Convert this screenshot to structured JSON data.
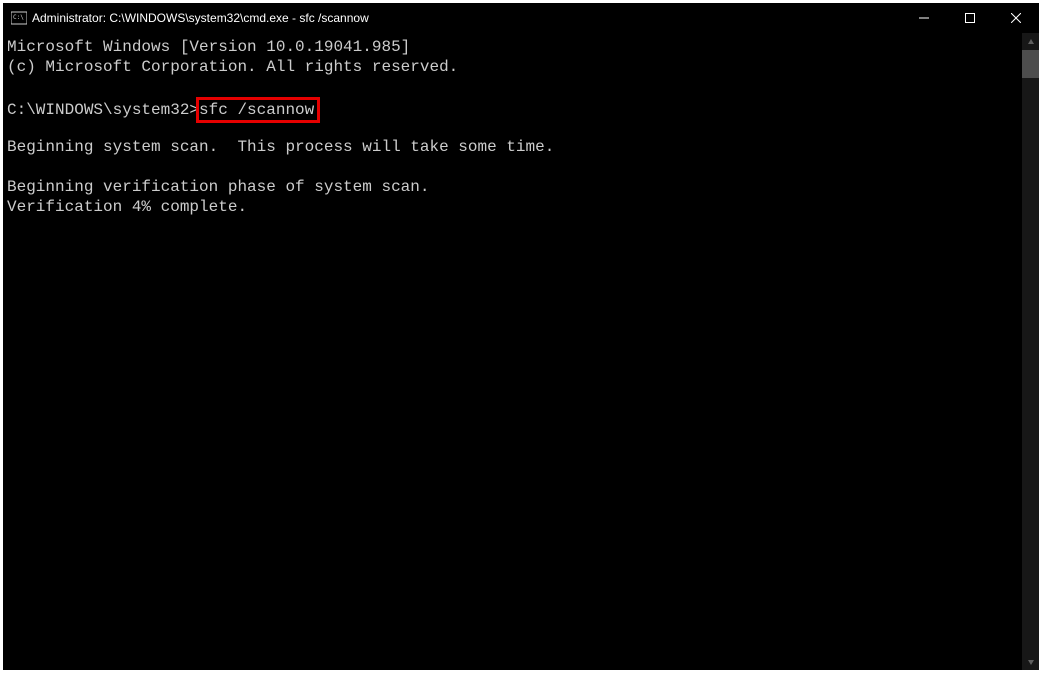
{
  "titlebar": {
    "title": "Administrator: C:\\WINDOWS\\system32\\cmd.exe - sfc  /scannow"
  },
  "terminal": {
    "line1": "Microsoft Windows [Version 10.0.19041.985]",
    "line2": "(c) Microsoft Corporation. All rights reserved.",
    "prompt": "C:\\WINDOWS\\system32>",
    "command": "sfc /scannow",
    "line4": "Beginning system scan.  This process will take some time.",
    "line5": "Beginning verification phase of system scan.",
    "line6": "Verification 4% complete."
  }
}
